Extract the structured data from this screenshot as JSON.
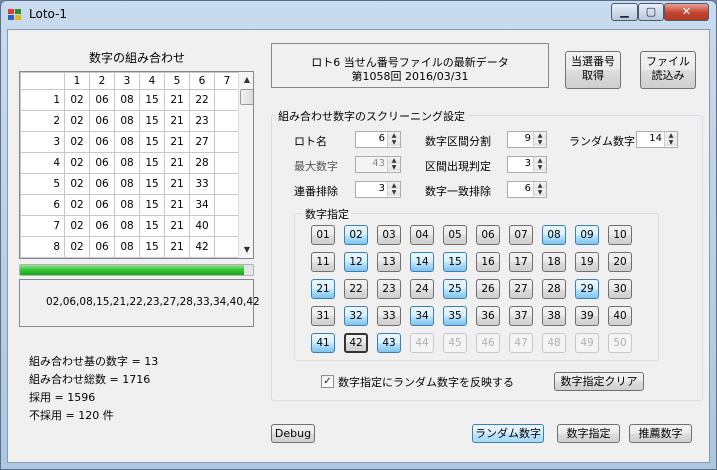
{
  "window": {
    "title": "Loto-1",
    "minimize": "▁",
    "maximize": "▢",
    "close": "✕"
  },
  "grid": {
    "title": "数字の組み合わせ",
    "columns": [
      "1",
      "2",
      "3",
      "4",
      "5",
      "6",
      "7"
    ],
    "rows": [
      {
        "n": "1",
        "v": [
          "02",
          "06",
          "08",
          "15",
          "21",
          "22",
          ""
        ]
      },
      {
        "n": "2",
        "v": [
          "02",
          "06",
          "08",
          "15",
          "21",
          "23",
          ""
        ]
      },
      {
        "n": "3",
        "v": [
          "02",
          "06",
          "08",
          "15",
          "21",
          "27",
          ""
        ]
      },
      {
        "n": "4",
        "v": [
          "02",
          "06",
          "08",
          "15",
          "21",
          "28",
          ""
        ]
      },
      {
        "n": "5",
        "v": [
          "02",
          "06",
          "08",
          "15",
          "21",
          "33",
          ""
        ]
      },
      {
        "n": "6",
        "v": [
          "02",
          "06",
          "08",
          "15",
          "21",
          "34",
          ""
        ]
      },
      {
        "n": "7",
        "v": [
          "02",
          "06",
          "08",
          "15",
          "21",
          "40",
          ""
        ]
      },
      {
        "n": "8",
        "v": [
          "02",
          "06",
          "08",
          "15",
          "21",
          "42",
          ""
        ]
      }
    ],
    "scroll_up": "▲",
    "scroll_down": "▼"
  },
  "progress": {
    "fraction": 0.96
  },
  "numbers_text": "02,06,08,15,21,22,23,27,28,33,34,40,42",
  "stats": {
    "base": "組み合わせ基の数字 = 13",
    "total": "組み合わせ総数 = 1716",
    "adopted": "採用 = 1596",
    "rejected": "不採用 = 120 件"
  },
  "info": {
    "line1": "ロト6 当せん番号ファイルの最新データ",
    "line2": "第1058回  2016/03/31"
  },
  "buttons": {
    "get_winning": "当選番号\n取得",
    "read_file": "ファイル\n読込み",
    "clear": "数字指定クリア",
    "debug": "Debug",
    "random": "ランダム数字",
    "specify": "数字指定",
    "recommend": "推薦数字"
  },
  "screening": {
    "title": "組み合わせ数字のスクリーニング設定",
    "loto_name": {
      "label": "ロト名",
      "value": "6"
    },
    "max_number": {
      "label": "最大数字",
      "value": "43"
    },
    "consecutive": {
      "label": "連番排除",
      "value": "3"
    },
    "section_split": {
      "label": "数字区間分割",
      "value": "9"
    },
    "section_judge": {
      "label": "区間出現判定",
      "value": "3"
    },
    "match_exclude": {
      "label": "数字一致排除",
      "value": "6"
    },
    "random_num": {
      "label": "ランダム数字",
      "value": "14"
    },
    "designation_title": "数字指定",
    "reflect_random": "数字指定にランダム数字を反映する",
    "reflect_checked": "✓"
  },
  "number_buttons": [
    {
      "n": "01",
      "s": "n"
    },
    {
      "n": "02",
      "s": "sel"
    },
    {
      "n": "03",
      "s": "n"
    },
    {
      "n": "04",
      "s": "n"
    },
    {
      "n": "05",
      "s": "n"
    },
    {
      "n": "06",
      "s": "n"
    },
    {
      "n": "07",
      "s": "n"
    },
    {
      "n": "08",
      "s": "sel"
    },
    {
      "n": "09",
      "s": "sel"
    },
    {
      "n": "10",
      "s": "n"
    },
    {
      "n": "11",
      "s": "n"
    },
    {
      "n": "12",
      "s": "sel"
    },
    {
      "n": "13",
      "s": "n"
    },
    {
      "n": "14",
      "s": "sel"
    },
    {
      "n": "15",
      "s": "sel"
    },
    {
      "n": "16",
      "s": "n"
    },
    {
      "n": "17",
      "s": "n"
    },
    {
      "n": "18",
      "s": "n"
    },
    {
      "n": "19",
      "s": "n"
    },
    {
      "n": "20",
      "s": "n"
    },
    {
      "n": "21",
      "s": "sel"
    },
    {
      "n": "22",
      "s": "n"
    },
    {
      "n": "23",
      "s": "n"
    },
    {
      "n": "24",
      "s": "n"
    },
    {
      "n": "25",
      "s": "sel"
    },
    {
      "n": "26",
      "s": "n"
    },
    {
      "n": "27",
      "s": "n"
    },
    {
      "n": "28",
      "s": "n"
    },
    {
      "n": "29",
      "s": "sel"
    },
    {
      "n": "30",
      "s": "n"
    },
    {
      "n": "31",
      "s": "n"
    },
    {
      "n": "32",
      "s": "sel"
    },
    {
      "n": "33",
      "s": "n"
    },
    {
      "n": "34",
      "s": "sel"
    },
    {
      "n": "35",
      "s": "sel"
    },
    {
      "n": "36",
      "s": "n"
    },
    {
      "n": "37",
      "s": "n"
    },
    {
      "n": "38",
      "s": "n"
    },
    {
      "n": "39",
      "s": "n"
    },
    {
      "n": "40",
      "s": "n"
    },
    {
      "n": "41",
      "s": "sel"
    },
    {
      "n": "42",
      "s": "cur"
    },
    {
      "n": "43",
      "s": "sel"
    },
    {
      "n": "44",
      "s": "dis"
    },
    {
      "n": "45",
      "s": "dis"
    },
    {
      "n": "46",
      "s": "dis"
    },
    {
      "n": "47",
      "s": "dis"
    },
    {
      "n": "48",
      "s": "dis"
    },
    {
      "n": "49",
      "s": "dis"
    },
    {
      "n": "50",
      "s": "dis"
    }
  ]
}
